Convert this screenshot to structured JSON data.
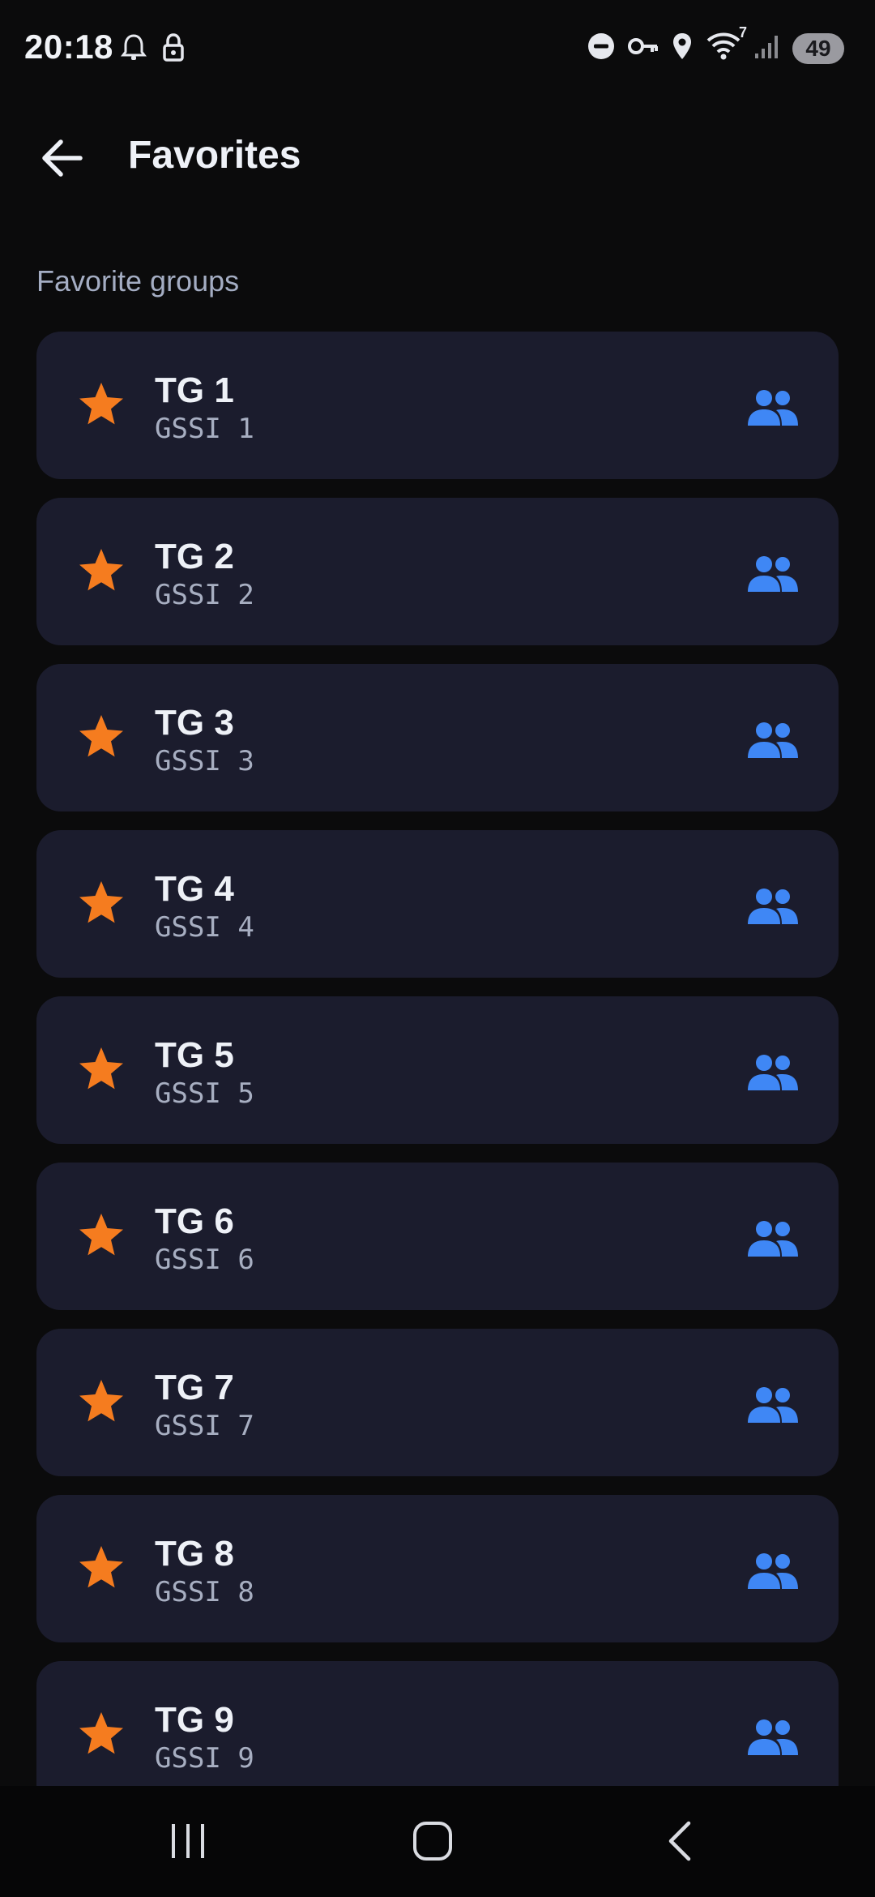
{
  "status_bar": {
    "time": "20:18",
    "battery": "49",
    "network_label": "7",
    "icons": [
      "alarm-icon",
      "lock-icon",
      "do-not-disturb-icon",
      "vpn-key-icon",
      "location-icon",
      "wifi-icon",
      "signal-icon",
      "battery-icon"
    ]
  },
  "header": {
    "title": "Favorites",
    "back_icon": "arrow-back-icon"
  },
  "section": {
    "title": "Favorite groups"
  },
  "groups": [
    {
      "name": "TG 1",
      "gssi": "GSSI 1"
    },
    {
      "name": "TG 2",
      "gssi": "GSSI 2"
    },
    {
      "name": "TG 3",
      "gssi": "GSSI 3"
    },
    {
      "name": "TG 4",
      "gssi": "GSSI 4"
    },
    {
      "name": "TG 5",
      "gssi": "GSSI 5"
    },
    {
      "name": "TG 6",
      "gssi": "GSSI 6"
    },
    {
      "name": "TG 7",
      "gssi": "GSSI 7"
    },
    {
      "name": "TG 8",
      "gssi": "GSSI 8"
    },
    {
      "name": "TG 9",
      "gssi": "GSSI 9"
    }
  ],
  "colors": {
    "background": "#0b0b0c",
    "card": "#1b1c2d",
    "star": "#f57c1f",
    "group_icon": "#3f87f5",
    "secondary_text": "#a7aec1"
  },
  "nav_bar": {
    "icons": [
      "recent-apps-icon",
      "home-icon",
      "back-icon"
    ]
  }
}
